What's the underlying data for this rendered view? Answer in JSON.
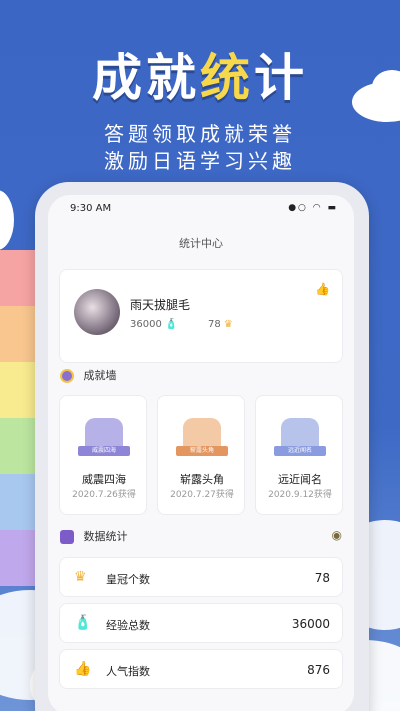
{
  "promo": {
    "headline_part1": "成就",
    "headline_highlight": "统",
    "headline_part2": "计",
    "subtitle_line1": "答题领取成就荣誉",
    "subtitle_line2": "激励日语学习兴趣"
  },
  "status_bar": {
    "time": "9:30 AM",
    "icons": "●○ ◠ ▬"
  },
  "page_title": "统计中心",
  "profile": {
    "username": "雨天拔腿毛",
    "experience": "36000",
    "crowns": "78",
    "like_icon": "thumbs-up-icon"
  },
  "achievements": {
    "heading": "成就墙",
    "badges": [
      {
        "ribbon": "威震四海",
        "name": "威震四海",
        "date": "2020.7.26获得",
        "color": "#b6b2e8",
        "ribbon_color": "#8d85d6"
      },
      {
        "ribbon": "崭露头角",
        "name": "崭露头角",
        "date": "2020.7.27获得",
        "color": "#f3c9a6",
        "ribbon_color": "#e3965f"
      },
      {
        "ribbon": "远近闻名",
        "name": "远近闻名",
        "date": "2020.9.12获得",
        "color": "#b8c3ec",
        "ribbon_color": "#8a9be0"
      }
    ]
  },
  "stats": {
    "heading": "数据统计",
    "rows": [
      {
        "label": "皇冠个数",
        "value": "78",
        "icon": "crown-icon"
      },
      {
        "label": "经验总数",
        "value": "36000",
        "icon": "lightning-bottle-icon"
      },
      {
        "label": "人气指数",
        "value": "876",
        "icon": "like-hand-icon"
      }
    ]
  }
}
